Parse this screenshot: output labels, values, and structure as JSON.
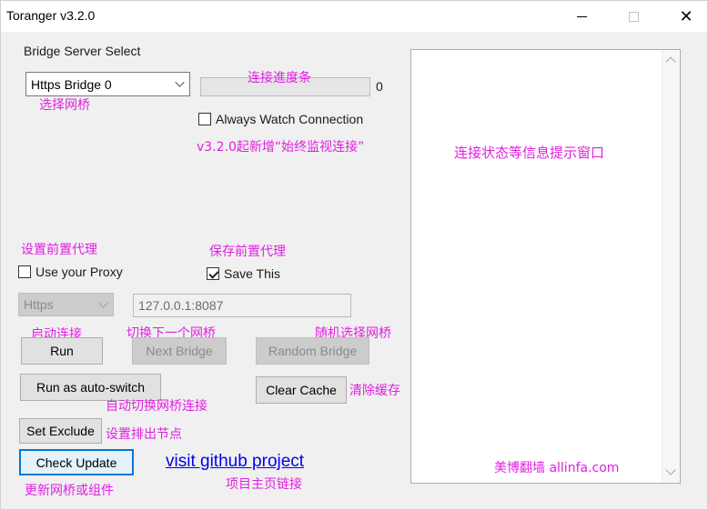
{
  "window": {
    "title": "Toranger v3.2.0",
    "controls": {
      "minimize": "minimize-icon",
      "maximize": "maximize-icon",
      "close": "close-icon"
    }
  },
  "bridge": {
    "section_label": "Bridge Server Select",
    "select_value": "Https Bridge 0",
    "progress_value": 0,
    "progress_text": "0",
    "always_watch_label": "Always Watch Connection",
    "always_watch_checked": false
  },
  "proxy": {
    "use_proxy_label": "Use your Proxy",
    "use_proxy_checked": false,
    "save_label": "Save This",
    "save_checked": true,
    "protocol_value": "Https",
    "address_value": "127.0.0.1:8087"
  },
  "buttons": {
    "run": "Run",
    "next_bridge": "Next Bridge",
    "random_bridge": "Random Bridge",
    "auto_switch": "Run as auto-switch",
    "clear_cache": "Clear Cache",
    "set_exclude": "Set Exclude",
    "check_update": "Check Update"
  },
  "link": {
    "text": "visit github project"
  },
  "annotations": {
    "select_bridge": "选择网桥",
    "progress_bar": "连接進度条",
    "always_watch": "v3.2.0起新增“始终监视连接”",
    "info_window": "连接状态等信息提示窗口",
    "set_proxy": "设置前置代理",
    "save_proxy": "保存前置代理",
    "start_connect": "启动连接",
    "next_bridge": "切换下一个网桥",
    "random_bridge": "随机选择网桥",
    "auto_switch": "自动切换网桥连接",
    "clear_cache": "清除缓存",
    "set_exclude": "设置排出节点",
    "check_update": "更新网桥或组件",
    "project_link": "项目主页链接",
    "watermark": "美博翻墙 allinfa.com"
  },
  "colors": {
    "annotation": "#e020e0",
    "link": "#0000ee",
    "focus": "#0078d7"
  }
}
